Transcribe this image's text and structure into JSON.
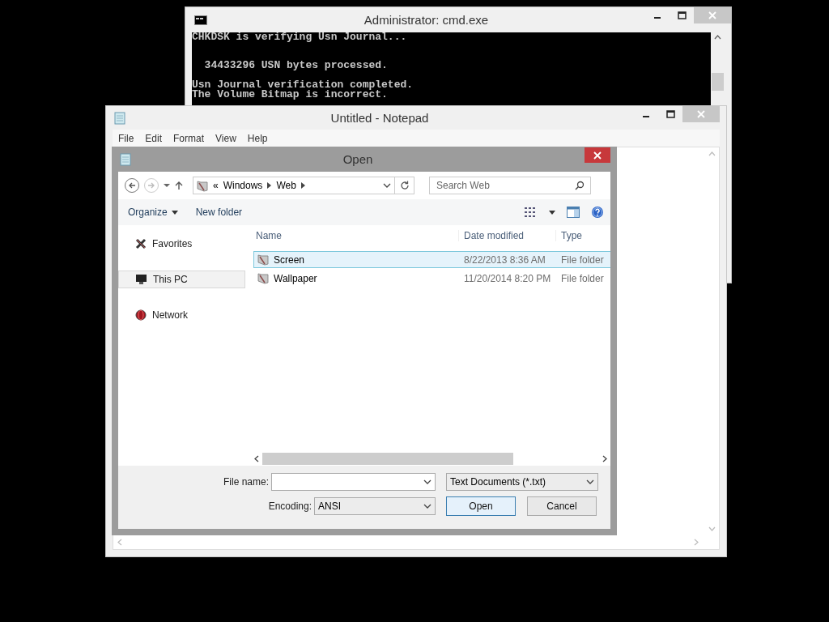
{
  "cmd_window": {
    "title": "Administrator: cmd.exe",
    "blocks": [
      [
        "CHKDSK is verifying Usn Journal..."
      ],
      [
        "  34433296 USN bytes processed."
      ],
      [
        "Usn Journal verification completed.",
        "The Volume Bitmap is incorrect."
      ]
    ]
  },
  "notepad_window": {
    "title": "Untitled - Notepad",
    "menu": [
      "File",
      "Edit",
      "Format",
      "View",
      "Help"
    ]
  },
  "open_dialog": {
    "title": "Open",
    "address": {
      "overflow": "«",
      "path": [
        "Windows",
        "Web"
      ]
    },
    "search": {
      "placeholder": "Search Web"
    },
    "toolbar": [
      "Organize",
      "New folder"
    ],
    "nav_pane": [
      {
        "label": "Favorites",
        "kind": "star",
        "selected": false
      },
      {
        "label": "This PC",
        "kind": "computer",
        "selected": true
      },
      {
        "label": "Network",
        "kind": "globe",
        "selected": false
      }
    ],
    "columns": [
      "Name",
      "Date modified",
      "Type"
    ],
    "rows": [
      {
        "name": "Screen",
        "date": "8/22/2013 8:36 AM",
        "type": "File folder",
        "selected": true
      },
      {
        "name": "Wallpaper",
        "date": "11/20/2014 8:20 PM",
        "type": "File folder",
        "selected": false
      }
    ],
    "file_name_label": "File name:",
    "file_type": "Text Documents (*.txt)",
    "encoding_label": "Encoding:",
    "encoding": "ANSI",
    "buttons": [
      "Open",
      "Cancel"
    ]
  }
}
